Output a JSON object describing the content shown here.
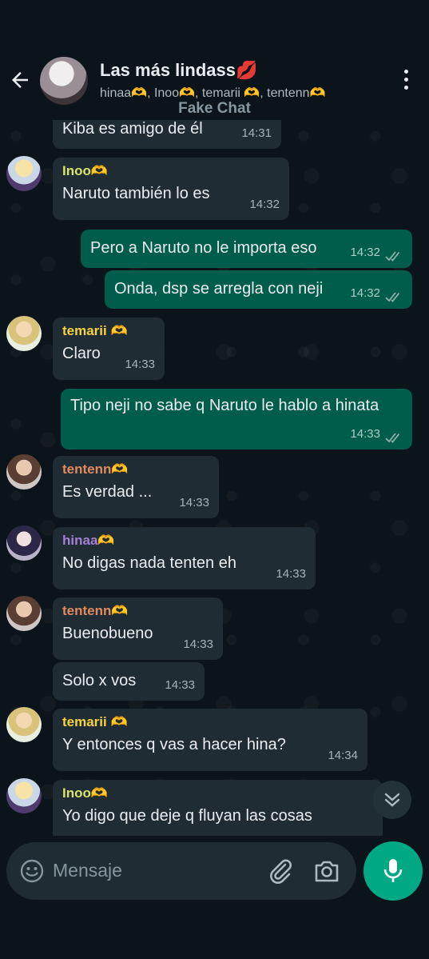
{
  "header": {
    "title": "Las más lindass💋",
    "subtitle": "hinaa🫶, Inoo🫶, temarii 🫶, tentenn🫶",
    "watermark": "Fake Chat"
  },
  "messages": [
    {
      "dir": "in",
      "text": "Kiba es amigo de él",
      "time": "14:31"
    },
    {
      "dir": "in",
      "sender": "Inoo🫶",
      "text": "Naruto también lo es",
      "time": "14:32"
    },
    {
      "dir": "out",
      "text": "Pero a Naruto no le importa eso",
      "time": "14:32"
    },
    {
      "dir": "out",
      "text": "Onda, dsp se arregla con neji",
      "time": "14:32"
    },
    {
      "dir": "in",
      "sender": "temarii 🫶",
      "text": "Claro",
      "time": "14:33"
    },
    {
      "dir": "out",
      "text": "Tipo neji no sabe q Naruto le hablo a hinata",
      "time": "14:33"
    },
    {
      "dir": "in",
      "sender": "tentenn🫶",
      "text": "Es verdad ...",
      "time": "14:33"
    },
    {
      "dir": "in",
      "sender": "hinaa🫶",
      "text": "No digas nada tenten eh",
      "time": "14:33"
    },
    {
      "dir": "in",
      "sender": "tentenn🫶",
      "text": "Buenobueno",
      "time": "14:33"
    },
    {
      "dir": "in",
      "text": "Solo x vos",
      "time": "14:33"
    },
    {
      "dir": "in",
      "sender": "temarii 🫶",
      "text": "Y entonces q vas a hacer hina?",
      "time": "14:34"
    },
    {
      "dir": "in",
      "sender": "Inoo🫶",
      "text": "Yo digo que deje q fluyan las cosas",
      "time": ""
    }
  ],
  "colors": {
    "Inoo": "#d9e36a",
    "temarii": "#f5d33f",
    "tentenn": "#e08a5e",
    "hinaa": "#a67fd6",
    "accent": "#00a884"
  },
  "input": {
    "placeholder": "Mensaje"
  }
}
